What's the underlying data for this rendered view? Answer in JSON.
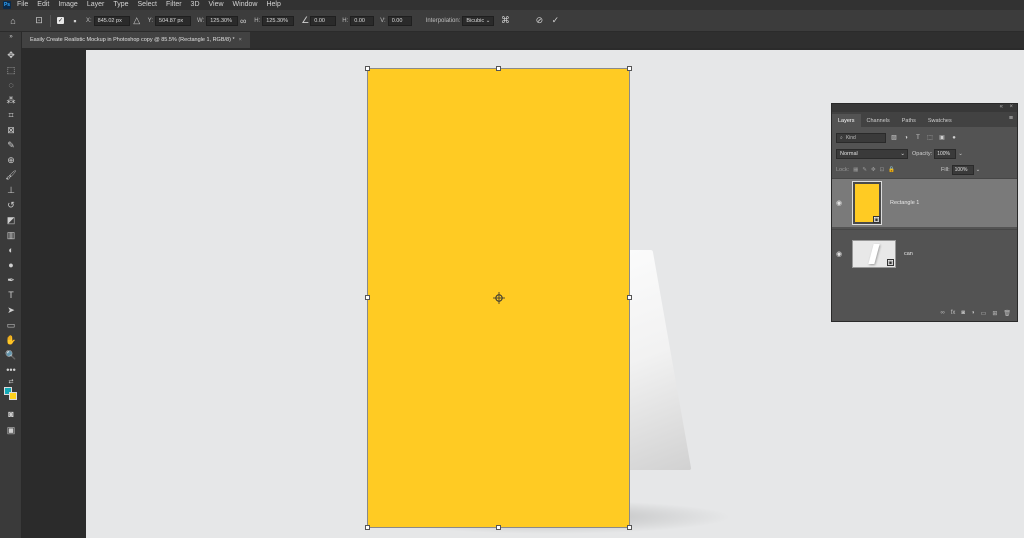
{
  "menu": {
    "logo": "Ps",
    "items": [
      "File",
      "Edit",
      "Image",
      "Layer",
      "Type",
      "Select",
      "Filter",
      "3D",
      "View",
      "Window",
      "Help"
    ]
  },
  "options": {
    "x_label": "X:",
    "x_value": "845.02 px",
    "y_label": "Y:",
    "y_value": "504.87 px",
    "w_label": "W:",
    "w_value": "125.30%",
    "h_label": "H:",
    "h_value": "125.30%",
    "angle_value": "0.00",
    "hskew_label": "H:",
    "hskew_value": "0.00",
    "vskew_label": "V:",
    "vskew_value": "0.00",
    "interpolation_label": "Interpolation:",
    "interpolation_value": "Bicubic"
  },
  "document": {
    "tab_title": "Easily Create Realistic Mockup in Photoshop copy @ 85.5% (Rectangle 1, RGB/8) *",
    "close": "×"
  },
  "layers_panel": {
    "tabs": [
      "Layers",
      "Channels",
      "Paths",
      "Swatches"
    ],
    "kind_placeholder": "Kind",
    "blend_mode": "Normal",
    "opacity_label": "Opacity:",
    "opacity_value": "100%",
    "lock_label": "Lock:",
    "fill_label": "Fill:",
    "fill_value": "100%",
    "layers": [
      {
        "name": "Rectangle 1",
        "selected": true
      },
      {
        "name": "can",
        "selected": false
      }
    ]
  },
  "colors": {
    "rectangle_fill": "#ffcb23",
    "foreground": "#14a8b6",
    "background": "#ffd21c"
  },
  "icons": {
    "toolbar": [
      "move-icon",
      "marquee-icon",
      "lasso-icon",
      "magic-wand-icon",
      "crop-icon",
      "frame-icon",
      "eyedropper-icon",
      "healing-icon",
      "brush-icon",
      "stamp-icon",
      "history-brush-icon",
      "eraser-icon",
      "gradient-icon",
      "blur-icon",
      "dodge-icon",
      "pen-icon",
      "type-icon",
      "path-select-icon",
      "shape-icon",
      "hand-icon",
      "zoom-icon",
      "more-icon"
    ]
  }
}
